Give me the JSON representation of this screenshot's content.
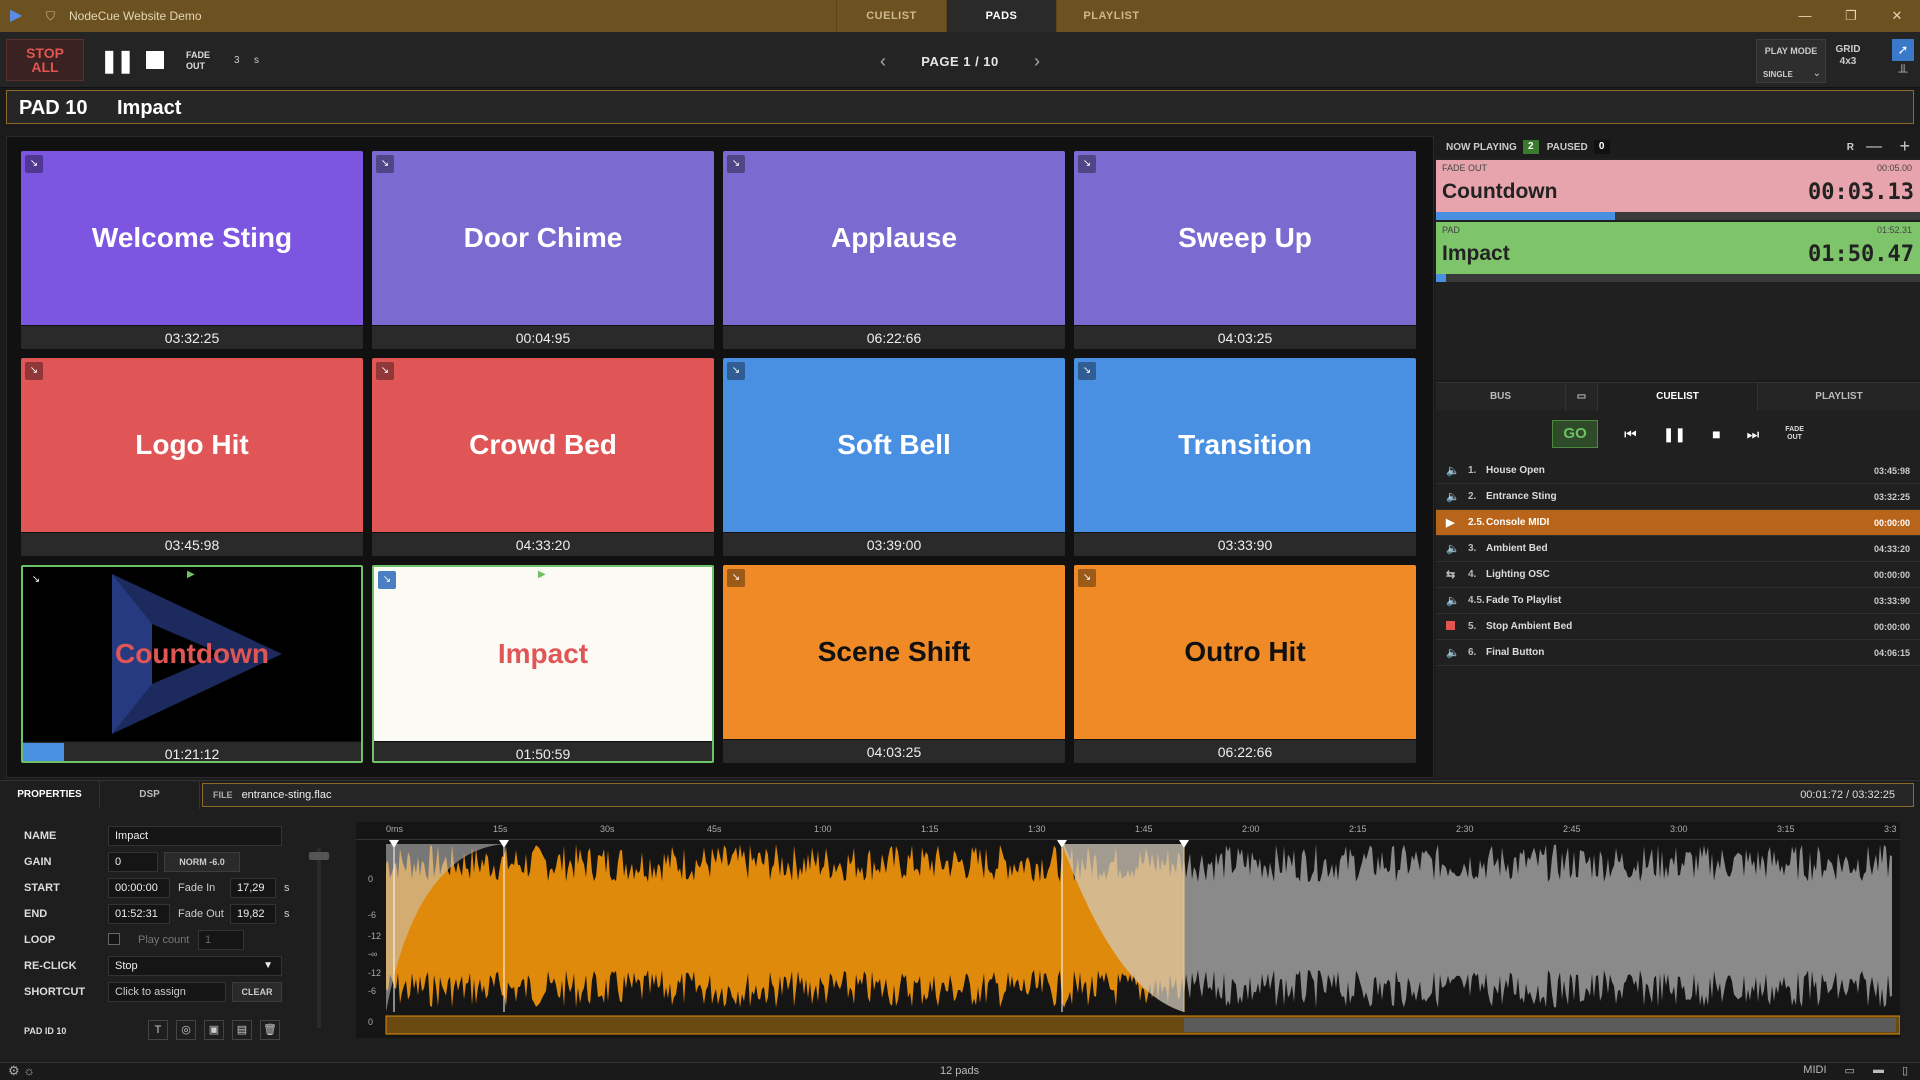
{
  "titlebar": {
    "title": "NodeCue Website Demo",
    "tabs": [
      "CUELIST",
      "PADS",
      "PLAYLIST"
    ],
    "active_tab": "PADS"
  },
  "toolbar": {
    "stop_all_line1": "STOP",
    "stop_all_line2": "ALL",
    "fade_line1": "FADE",
    "fade_line2": "OUT",
    "fade_value": "3",
    "fade_unit": "s",
    "page_label": "PAGE 1 / 10",
    "play_mode_label": "PLAY MODE",
    "play_mode_value": "SINGLE",
    "grid_label": "GRID",
    "grid_value": "4x3"
  },
  "selected_pad": {
    "id_label": "PAD 10",
    "name": "Impact"
  },
  "pads": [
    {
      "name": "Welcome Sting",
      "time": "03:32:25",
      "color": "#7c55e0"
    },
    {
      "name": "Door Chime",
      "time": "00:04:95",
      "color": "#7b6bd0"
    },
    {
      "name": "Applause",
      "time": "06:22:66",
      "color": "#7b6bd0"
    },
    {
      "name": "Sweep Up",
      "time": "04:03:25",
      "color": "#7b6bd0"
    },
    {
      "name": "Logo Hit",
      "time": "03:45:98",
      "color": "#e05555"
    },
    {
      "name": "Crowd Bed",
      "time": "04:33:20",
      "color": "#e05555"
    },
    {
      "name": "Soft Bell",
      "time": "03:39:00",
      "color": "#4a90e2"
    },
    {
      "name": "Transition",
      "time": "03:33:90",
      "color": "#4a90e2"
    },
    {
      "name": "Countdown",
      "time": "01:21:12",
      "color": "#000000",
      "progress": 0.12
    },
    {
      "name": "Impact",
      "time": "01:50:59",
      "color": "#fbfaf5"
    },
    {
      "name": "Scene Shift",
      "time": "04:03:25",
      "color": "#f08a26"
    },
    {
      "name": "Outro Hit",
      "time": "06:22:66",
      "color": "#f08a26"
    }
  ],
  "now_playing": {
    "label": "NOW PLAYING",
    "playing_count": "2",
    "paused_label": "PAUSED",
    "paused_count": "0",
    "r_label": "R",
    "items": [
      {
        "status": "FADE OUT",
        "total": "00:05.00",
        "name": "Countdown",
        "time": "00:03.13",
        "color": "#e8a4ac",
        "progress": 0.37
      },
      {
        "status": "PAD",
        "total": "01:52.31",
        "name": "Impact",
        "time": "01:50.47",
        "color": "#7ec46b",
        "progress": 0.02
      }
    ]
  },
  "cue_panel": {
    "tabs": [
      "BUS",
      "CUELIST",
      "PLAYLIST"
    ],
    "go_label": "GO",
    "fade_line1": "FADE",
    "fade_line2": "OUT",
    "rows": [
      {
        "icon": "speaker-icon",
        "num": "1.",
        "name": "House Open",
        "dur": "03:45:98"
      },
      {
        "icon": "speaker-icon",
        "num": "2.",
        "name": "Entrance Sting",
        "dur": "03:32:25"
      },
      {
        "icon": "play-icon",
        "num": "2.5.",
        "name": "Console MIDI",
        "dur": "00:00:00",
        "active": true
      },
      {
        "icon": "speaker-icon",
        "num": "3.",
        "name": "Ambient Bed",
        "dur": "04:33:20"
      },
      {
        "icon": "osc-icon",
        "num": "4.",
        "name": "Lighting OSC",
        "dur": "00:00:00"
      },
      {
        "icon": "speaker-icon",
        "num": "4.5.",
        "name": "Fade To Playlist",
        "dur": "03:33:90"
      },
      {
        "icon": "stop-icon",
        "num": "5.",
        "name": "Stop Ambient Bed",
        "dur": "00:00:00"
      },
      {
        "icon": "speaker-icon",
        "num": "6.",
        "name": "Final Button",
        "dur": "04:06:15"
      }
    ]
  },
  "properties": {
    "tabs": [
      "PROPERTIES",
      "DSP"
    ],
    "file_label": "FILE",
    "file_name": "entrance-sting.flac",
    "file_time": "00:01:72 / 03:32:25",
    "name_label": "NAME",
    "name_value": "Impact",
    "gain_label": "GAIN",
    "gain_value": "0",
    "norm_label": "NORM -6.0",
    "start_label": "START",
    "start_value": "00:00:00",
    "fade_in_label": "Fade In",
    "fade_in_value": "17,29",
    "fade_in_unit": "s",
    "end_label": "END",
    "end_value": "01:52:31",
    "fade_out_label": "Fade Out",
    "fade_out_value": "19,82",
    "fade_out_unit": "s",
    "loop_label": "LOOP",
    "play_count_label": "Play count",
    "play_count_value": "1",
    "reclick_label": "RE-CLICK",
    "reclick_value": "Stop",
    "shortcut_label": "SHORTCUT",
    "shortcut_value": "Click to assign",
    "clear_label": "CLEAR",
    "pad_id_label": "PAD ID 10"
  },
  "waveform": {
    "ticks": [
      "0ms",
      "15s",
      "30s",
      "45s",
      "1:00",
      "1:15",
      "1:30",
      "1:45",
      "2:00",
      "2:15",
      "2:30",
      "2:45",
      "3:00",
      "3:15",
      "3:3"
    ],
    "db_labels": [
      "0",
      "-6",
      "-12",
      "-∞",
      "-12",
      "-6",
      "0"
    ],
    "active_color": "#e08a0b",
    "inactive_color": "#8a8a8a"
  },
  "status": {
    "pad_count": "12 pads",
    "midi_label": "MIDI"
  }
}
